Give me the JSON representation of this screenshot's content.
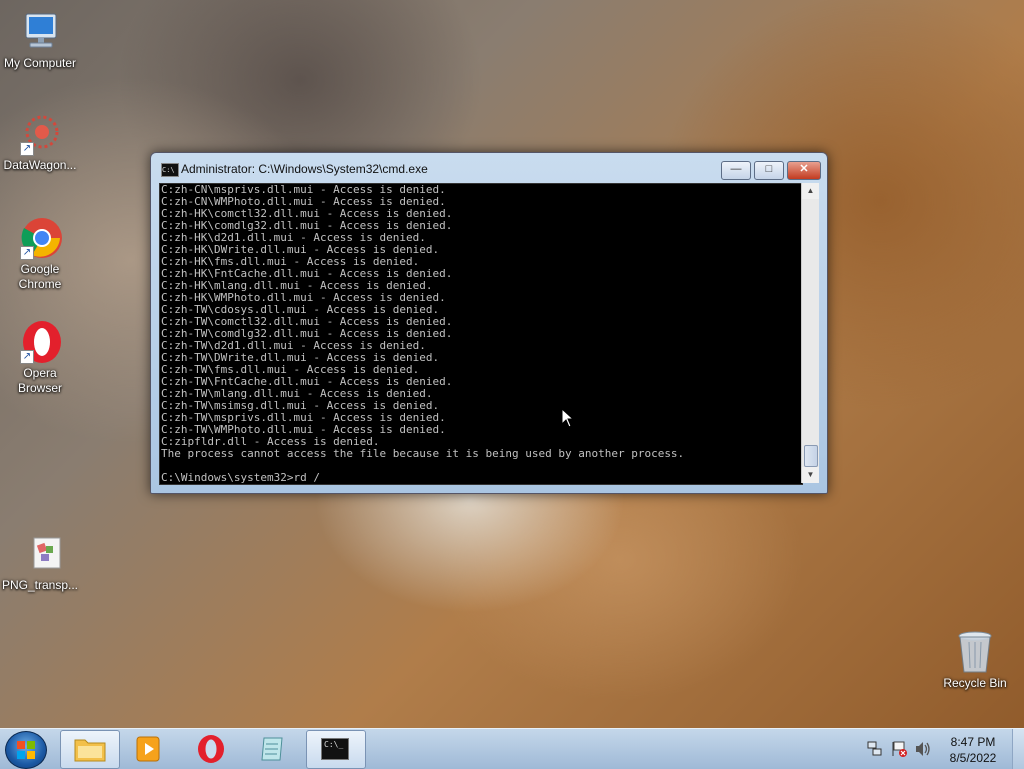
{
  "desktop": {
    "icons": [
      {
        "label": "My Computer",
        "icon": "computer-icon"
      },
      {
        "label": "DataWagon...",
        "icon": "datawagon-icon"
      },
      {
        "label": "Google Chrome",
        "icon": "chrome-icon"
      },
      {
        "label": "Opera Browser",
        "icon": "opera-icon"
      },
      {
        "label": "PNG_transp...",
        "icon": "png-file-icon"
      },
      {
        "label": "Recycle Bin",
        "icon": "recycle-bin-icon"
      }
    ]
  },
  "cmd_window": {
    "title": "Administrator: C:\\Windows\\System32\\cmd.exe",
    "icon_text": "C:\\",
    "minimize": "—",
    "maximize": "□",
    "close": "✕",
    "lines": [
      "C:zh-CN\\msprivs.dll.mui - Access is denied.",
      "C:zh-CN\\WMPhoto.dll.mui - Access is denied.",
      "C:zh-HK\\comctl32.dll.mui - Access is denied.",
      "C:zh-HK\\comdlg32.dll.mui - Access is denied.",
      "C:zh-HK\\d2d1.dll.mui - Access is denied.",
      "C:zh-HK\\DWrite.dll.mui - Access is denied.",
      "C:zh-HK\\fms.dll.mui - Access is denied.",
      "C:zh-HK\\FntCache.dll.mui - Access is denied.",
      "C:zh-HK\\mlang.dll.mui - Access is denied.",
      "C:zh-HK\\WMPhoto.dll.mui - Access is denied.",
      "C:zh-TW\\cdosys.dll.mui - Access is denied.",
      "C:zh-TW\\comctl32.dll.mui - Access is denied.",
      "C:zh-TW\\comdlg32.dll.mui - Access is denied.",
      "C:zh-TW\\d2d1.dll.mui - Access is denied.",
      "C:zh-TW\\DWrite.dll.mui - Access is denied.",
      "C:zh-TW\\fms.dll.mui - Access is denied.",
      "C:zh-TW\\FntCache.dll.mui - Access is denied.",
      "C:zh-TW\\mlang.dll.mui - Access is denied.",
      "C:zh-TW\\msimsg.dll.mui - Access is denied.",
      "C:zh-TW\\msprivs.dll.mui - Access is denied.",
      "C:zh-TW\\WMPhoto.dll.mui - Access is denied.",
      "C:zipfldr.dll - Access is denied.",
      "The process cannot access the file because it is being used by another process.",
      "",
      "C:\\Windows\\system32>rd /"
    ]
  },
  "taskbar": {
    "items": [
      {
        "name": "windows-explorer",
        "icon": "folder-icon"
      },
      {
        "name": "media-player",
        "icon": "media-player-icon"
      },
      {
        "name": "opera",
        "icon": "opera-icon"
      },
      {
        "name": "notepad",
        "icon": "notepad-icon"
      },
      {
        "name": "cmd",
        "icon": "cmd-icon",
        "icon_text": "C:\\_"
      }
    ],
    "clock_time": "8:47 PM",
    "clock_date": "8/5/2022"
  }
}
